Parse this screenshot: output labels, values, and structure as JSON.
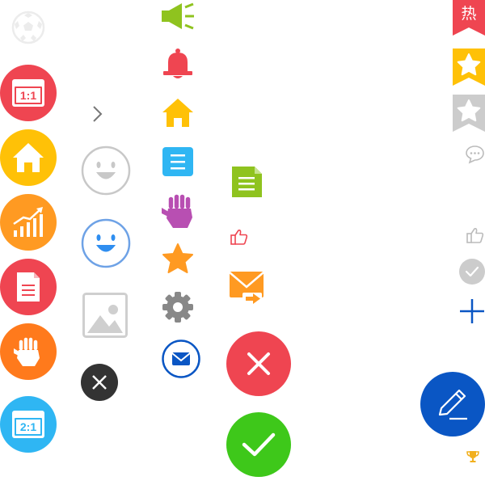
{
  "palette": {
    "red": "#ef4551",
    "yellow": "#ffc107",
    "orange": "#ff9a22",
    "blue": "#2fb6f3",
    "green": "#8fc31f",
    "purple": "#b84fb2",
    "navy": "#0a56c4",
    "check_green": "#3ec81a",
    "gray": "#cccccc"
  },
  "icons": {
    "ratio_1_1": "1:1",
    "ratio_2_1": "2:1"
  },
  "badges": {
    "hot": "热"
  }
}
